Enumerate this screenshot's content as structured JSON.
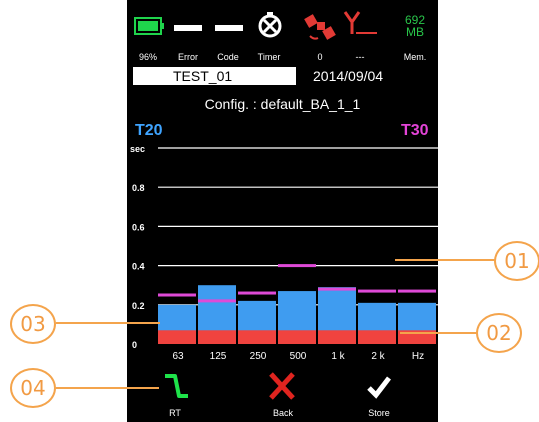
{
  "status_bar": {
    "battery_label": "96%",
    "error_label": "Error",
    "code_label": "Code",
    "timer_label": "Timer",
    "satellite_label": "0",
    "antenna_label": "---",
    "memory_value_line1": "692",
    "memory_value_line2": "MB",
    "memory_label": "Mem."
  },
  "header": {
    "test_name": "TEST_01",
    "date": "2014/09/04",
    "config": "Config. : default_BA_1_1"
  },
  "chart_data": {
    "type": "bar",
    "left_label": "T20",
    "right_label": "T30",
    "y_unit": "sec",
    "y_ticks": [
      "0.8",
      "0.6",
      "0.4",
      "0.2",
      "0"
    ],
    "ylim": [
      0,
      1.0
    ],
    "categories": [
      "63",
      "125",
      "250",
      "500",
      "1 k",
      "2 k",
      "Hz"
    ],
    "series": [
      {
        "values": [
          0.2,
          0.3,
          0.22,
          0.27,
          0.29,
          0.21,
          0.21
        ]
      },
      {
        "values": [
          0.25,
          0.22,
          0.26,
          0.4,
          0.28,
          0.27,
          0.27
        ]
      },
      {
        "values": [
          0.07,
          0.07,
          0.07,
          0.07,
          0.07,
          0.07,
          0.07
        ]
      }
    ],
    "colors": {
      "t20": "#3f9cf0",
      "t30": "#df4ad7",
      "low": "#f0433f",
      "gridline": "#ffffff"
    },
    "grid": true
  },
  "softkeys": {
    "rt_label": "RT",
    "back_label": "Back",
    "store_label": "Store"
  },
  "callouts": [
    "01",
    "02",
    "03",
    "04"
  ],
  "colors": {
    "battery": "#1fd44c",
    "memory": "#29c54a",
    "satellite": "#e23a35",
    "softkey_rt": "#1ee34a",
    "softkey_back": "#e0241f",
    "callout": "#f4a44c"
  }
}
